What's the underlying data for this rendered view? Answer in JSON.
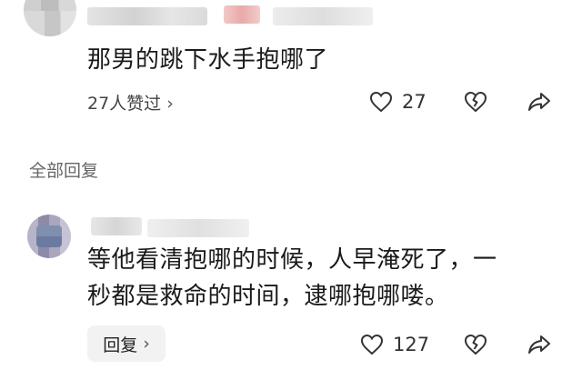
{
  "comment": {
    "text": "那男的跳下水手抱哪了",
    "likes_label": "27人赞过",
    "like_count": "27"
  },
  "all_replies_label": "全部回复",
  "reply": {
    "text_line1": "等他看清抱哪的时候，人早淹死了，一",
    "text_line2": "秒都是救命的时间，逮哪抱哪喽。",
    "reply_button_label": "回复",
    "like_count": "127"
  },
  "icons": {
    "like": "heart-icon",
    "dislike": "broken-heart-icon",
    "share": "share-arrow-icon",
    "chevron": "chevron-right-icon"
  },
  "colors": {
    "text": "#1a1a1a",
    "muted": "#666666",
    "icon": "#333333",
    "button_bg": "#f2f2f2"
  }
}
